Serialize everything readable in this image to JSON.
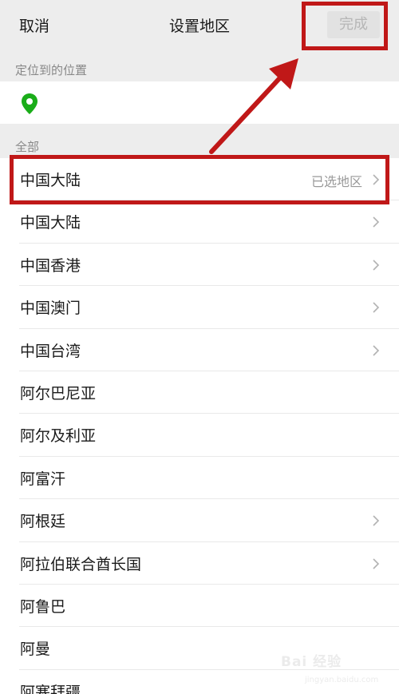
{
  "header": {
    "cancel_label": "取消",
    "title": "设置地区",
    "done_label": "完成"
  },
  "location_section": {
    "label": "定位到的位置",
    "icon": "map-pin-icon",
    "icon_color": "#1aad19"
  },
  "all_section": {
    "label": "全部"
  },
  "regions": [
    {
      "name": "中国大陆",
      "status": "已选地区",
      "has_chevron": true
    },
    {
      "name": "中国大陆",
      "status": "",
      "has_chevron": true
    },
    {
      "name": "中国香港",
      "status": "",
      "has_chevron": true
    },
    {
      "name": "中国澳门",
      "status": "",
      "has_chevron": true
    },
    {
      "name": "中国台湾",
      "status": "",
      "has_chevron": true
    },
    {
      "name": "阿尔巴尼亚",
      "status": "",
      "has_chevron": false
    },
    {
      "name": "阿尔及利亚",
      "status": "",
      "has_chevron": false
    },
    {
      "name": "阿富汗",
      "status": "",
      "has_chevron": false
    },
    {
      "name": "阿根廷",
      "status": "",
      "has_chevron": true
    },
    {
      "name": "阿拉伯联合酋长国",
      "status": "",
      "has_chevron": true
    },
    {
      "name": "阿鲁巴",
      "status": "",
      "has_chevron": false
    },
    {
      "name": "阿曼",
      "status": "",
      "has_chevron": false
    },
    {
      "name": "阿塞拜疆",
      "status": "",
      "has_chevron": false
    }
  ],
  "annotation": {
    "color": "#c01818"
  },
  "watermark": {
    "brand": "Bai 经验",
    "url": "jingyan.baidu.com"
  }
}
